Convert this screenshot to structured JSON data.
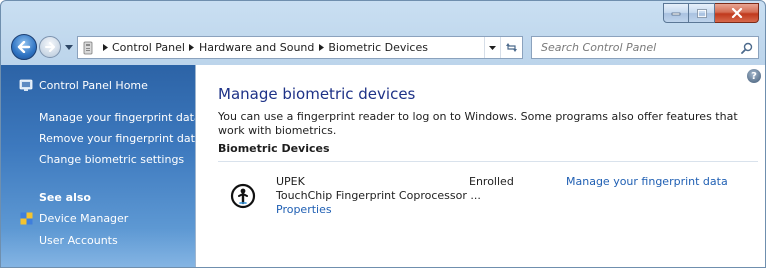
{
  "window": {
    "caption_buttons": [
      "minimize-icon",
      "maximize-icon",
      "close-icon"
    ]
  },
  "nav": {
    "back_icon": "back-arrow-icon",
    "forward_icon": "forward-arrow-icon"
  },
  "address": {
    "crumbs": [
      "Control Panel",
      "Hardware and Sound",
      "Biometric Devices"
    ],
    "folder_icon": "control-panel-icon"
  },
  "search": {
    "placeholder": "Search Control Panel",
    "icon": "search-icon"
  },
  "sidebar": {
    "home_label": "Control Panel Home",
    "links": [
      "Manage your fingerprint data",
      "Remove your fingerprint data",
      "Change biometric settings"
    ],
    "see_also_label": "See also",
    "see_also": [
      "Device Manager",
      "User Accounts"
    ]
  },
  "main": {
    "title": "Manage biometric devices",
    "intro": "You can use a fingerprint reader to log on to Windows. Some programs also offer features that work with biometrics.",
    "section_heading": "Biometric Devices",
    "device": {
      "name": "UPEK",
      "description": "TouchChip Fingerprint Coprocessor ...",
      "properties_link": "Properties",
      "status": "Enrolled",
      "manage_link": "Manage your fingerprint data"
    }
  },
  "colors": {
    "title_blue": "#1e3287",
    "link_blue": "#1f5fb3",
    "sidebar_top": "#2c63a6",
    "sidebar_bottom": "#86b6e4"
  }
}
